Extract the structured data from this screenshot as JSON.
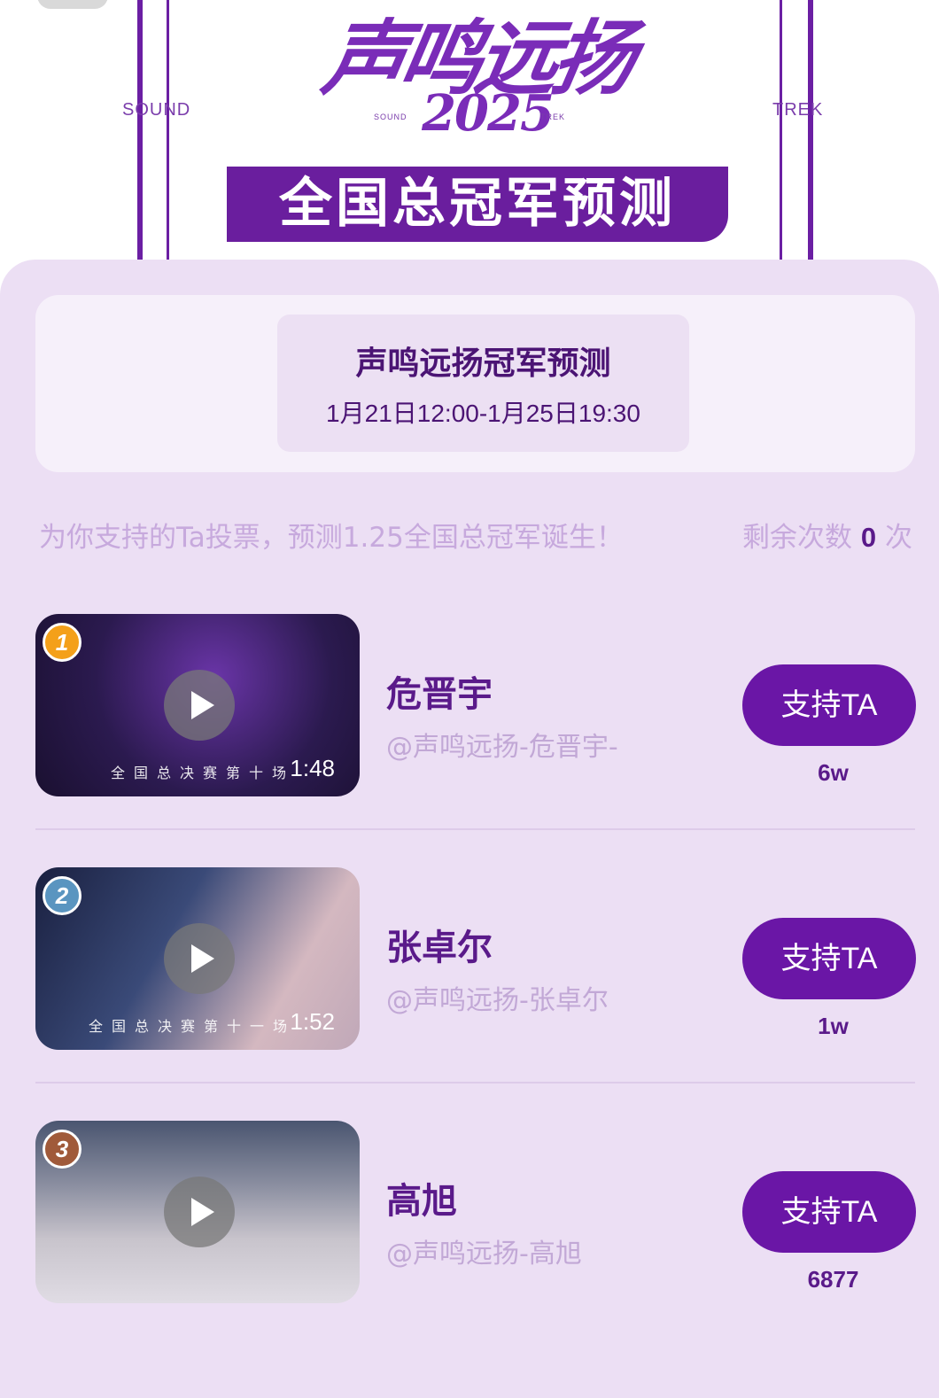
{
  "banner": {
    "side_left": "SOUND",
    "side_right": "TREK",
    "logo_title": "声鸣远扬",
    "logo_year": "2025",
    "logo_small_left": "SOUND",
    "logo_small_right": "TREK",
    "headline": "全国总冠军预测"
  },
  "info": {
    "title": "声鸣远扬冠军预测",
    "date_range": "1月21日12:00-1月25日19:30"
  },
  "hint": "为你支持的Ta投票，预测1.25全国总冠军诞生！",
  "remaining": {
    "label": "剩余次数",
    "count": "0",
    "unit": "次"
  },
  "candidates": [
    {
      "rank": "1",
      "rank_color": "#f4a01a",
      "name": "危晋宇",
      "handle": "@声鸣远扬-危晋宇-",
      "duration": "1:48",
      "caption": "全国总决赛第十场",
      "button": "支持TA",
      "votes": "6w",
      "thumb_colors": [
        "#2b1a4f",
        "#6a35a8",
        "#1a1030"
      ]
    },
    {
      "rank": "2",
      "rank_color": "#5a95c0",
      "name": "张卓尔",
      "handle": "@声鸣远扬-张卓尔",
      "duration": "1:52",
      "caption": "全国总决赛第十一场",
      "button": "支持TA",
      "votes": "1w",
      "thumb_colors": [
        "#1a2040",
        "#4a5a88",
        "#d4b8c0"
      ]
    },
    {
      "rank": "3",
      "rank_color": "#a05a3a",
      "name": "高旭",
      "handle": "@声鸣远扬-高旭",
      "duration": "",
      "caption": "",
      "button": "支持TA",
      "votes": "6877",
      "thumb_colors": [
        "#4a5570",
        "#c8c4cc",
        "#e0dce4"
      ]
    }
  ]
}
